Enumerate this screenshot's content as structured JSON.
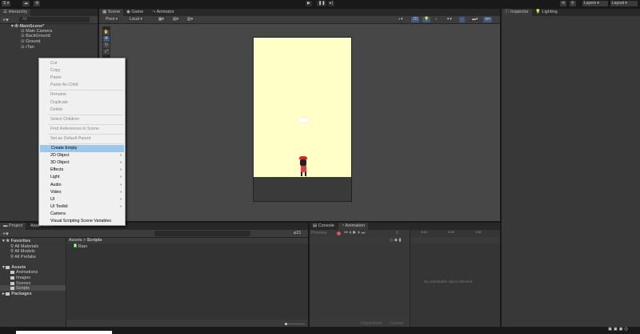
{
  "toolbar": {
    "account": "S ▾",
    "layers": "Layers",
    "layout": "Layout"
  },
  "hierarchy": {
    "title": "Hierarchy",
    "search_placeholder": "All",
    "scene": "MainScene*",
    "objects": [
      "Main Camera",
      "BackGround",
      "Ground",
      "rTan"
    ]
  },
  "scene_tabs": [
    "Scene",
    "Game",
    "Animator"
  ],
  "scene_toolbar": {
    "pivot": "Pivot",
    "local": "Local",
    "mode_2d": "2D"
  },
  "context_menu": {
    "groups": [
      [
        {
          "label": "Cut",
          "disabled": true
        },
        {
          "label": "Copy",
          "disabled": true
        },
        {
          "label": "Paste",
          "disabled": true
        },
        {
          "label": "Paste As Child",
          "disabled": true
        }
      ],
      [
        {
          "label": "Rename",
          "disabled": true
        },
        {
          "label": "Duplicate",
          "disabled": true
        },
        {
          "label": "Delete",
          "disabled": true
        }
      ],
      [
        {
          "label": "Select Children",
          "disabled": true
        }
      ],
      [
        {
          "label": "Find References in Scene",
          "disabled": true
        }
      ],
      [
        {
          "label": "Set as Default Parent",
          "disabled": true
        }
      ],
      [
        {
          "label": "Create Empty",
          "selected": true
        },
        {
          "label": "2D Object",
          "sub": true
        },
        {
          "label": "3D Object",
          "sub": true
        },
        {
          "label": "Effects",
          "sub": true
        },
        {
          "label": "Light",
          "sub": true
        },
        {
          "label": "Audio",
          "sub": true
        },
        {
          "label": "Video",
          "sub": true
        },
        {
          "label": "UI",
          "sub": true
        },
        {
          "label": "UI Toolkit",
          "sub": true
        },
        {
          "label": "Camera"
        },
        {
          "label": "Visual Scripting Scene Variables"
        }
      ]
    ]
  },
  "project": {
    "tabs": [
      "Project",
      "Asset Store"
    ],
    "favorites": "Favorites",
    "fav_items": [
      "All Materials",
      "All Models",
      "All Prefabs"
    ],
    "assets": "Assets",
    "asset_folders": [
      "Animations",
      "Images",
      "Scenes",
      "Scripts"
    ],
    "packages": "Packages",
    "breadcrumb_root": "Assets",
    "breadcrumb_sep": ">",
    "breadcrumb_current": "Scripts",
    "files": [
      "Rtan"
    ],
    "hidden_count": "21"
  },
  "animation": {
    "tabs": [
      "Console",
      "Animation"
    ],
    "preview": "Preview",
    "frame": "0",
    "timeline": [
      "0:00",
      "0:30",
      "1:00"
    ],
    "empty_message": "No animatable object selected.",
    "dopesheet": "Dopesheet",
    "curves": "Curves"
  },
  "inspector": {
    "tabs": [
      "Inspector",
      "Lighting"
    ]
  },
  "colors": {
    "selection": "#99c9ef",
    "sky": "#ffffc8",
    "ground": "#3a3a3a",
    "accent": "#3d5a80"
  }
}
